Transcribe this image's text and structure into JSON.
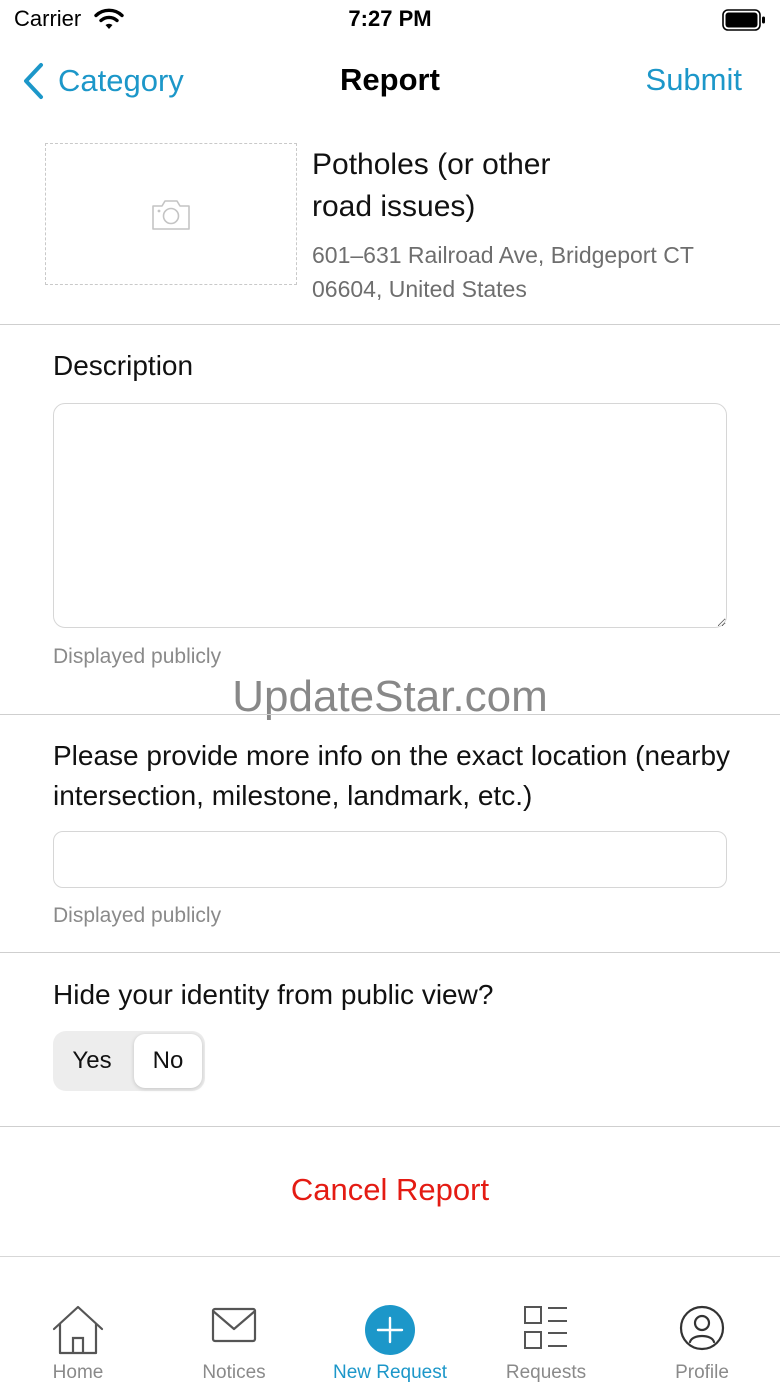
{
  "status_bar": {
    "carrier": "Carrier",
    "time": "7:27 PM"
  },
  "nav": {
    "back_label": "Category",
    "title": "Report",
    "submit_label": "Submit"
  },
  "report": {
    "category": "Potholes (or other road issues)",
    "address": "601–631 Railroad Ave, Bridgeport CT 06604, United States"
  },
  "description": {
    "label": "Description",
    "value": "",
    "helper": "Displayed publicly"
  },
  "location_info": {
    "label": "Please provide more info on the exact location (nearby intersection, milestone, landmark, etc.)",
    "value": "",
    "helper": "Displayed publicly"
  },
  "identity": {
    "label": "Hide your identity from public view?",
    "options": [
      "Yes",
      "No"
    ],
    "selected": "No"
  },
  "cancel_label": "Cancel Report",
  "watermark": "UpdateStar.com",
  "tabs": [
    {
      "label": "Home",
      "icon": "home-icon"
    },
    {
      "label": "Notices",
      "icon": "envelope-icon"
    },
    {
      "label": "New Request",
      "icon": "plus-circle-icon",
      "active": true
    },
    {
      "label": "Requests",
      "icon": "list-icon"
    },
    {
      "label": "Profile",
      "icon": "person-icon"
    }
  ],
  "colors": {
    "accent": "#1c97c9",
    "destructive": "#e41b13",
    "secondary_text": "#8a8a8a"
  }
}
